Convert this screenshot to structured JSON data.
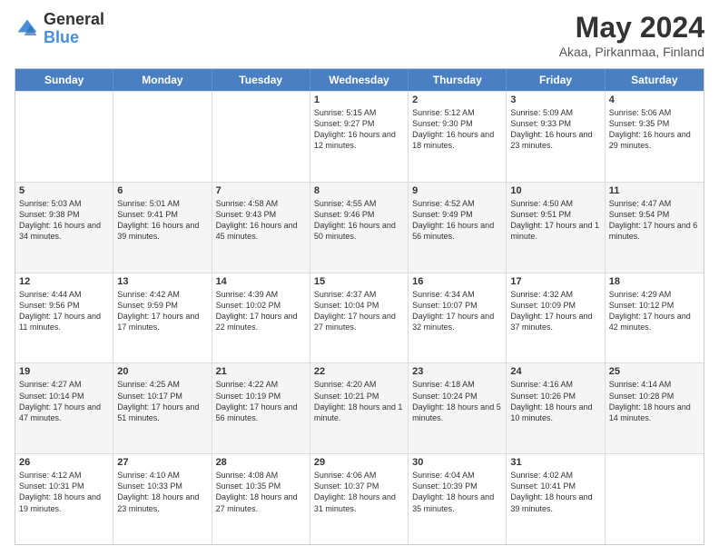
{
  "logo": {
    "general": "General",
    "blue": "Blue"
  },
  "title": "May 2024",
  "subtitle": "Akaa, Pirkanmaa, Finland",
  "days_of_week": [
    "Sunday",
    "Monday",
    "Tuesday",
    "Wednesday",
    "Thursday",
    "Friday",
    "Saturday"
  ],
  "weeks": [
    [
      {
        "day": "",
        "info": "",
        "empty": true
      },
      {
        "day": "",
        "info": "",
        "empty": true
      },
      {
        "day": "",
        "info": "",
        "empty": true
      },
      {
        "day": "1",
        "info": "Sunrise: 5:15 AM\nSunset: 9:27 PM\nDaylight: 16 hours\nand 12 minutes."
      },
      {
        "day": "2",
        "info": "Sunrise: 5:12 AM\nSunset: 9:30 PM\nDaylight: 16 hours\nand 18 minutes."
      },
      {
        "day": "3",
        "info": "Sunrise: 5:09 AM\nSunset: 9:33 PM\nDaylight: 16 hours\nand 23 minutes."
      },
      {
        "day": "4",
        "info": "Sunrise: 5:06 AM\nSunset: 9:35 PM\nDaylight: 16 hours\nand 29 minutes."
      }
    ],
    [
      {
        "day": "5",
        "info": "Sunrise: 5:03 AM\nSunset: 9:38 PM\nDaylight: 16 hours\nand 34 minutes."
      },
      {
        "day": "6",
        "info": "Sunrise: 5:01 AM\nSunset: 9:41 PM\nDaylight: 16 hours\nand 39 minutes."
      },
      {
        "day": "7",
        "info": "Sunrise: 4:58 AM\nSunset: 9:43 PM\nDaylight: 16 hours\nand 45 minutes."
      },
      {
        "day": "8",
        "info": "Sunrise: 4:55 AM\nSunset: 9:46 PM\nDaylight: 16 hours\nand 50 minutes."
      },
      {
        "day": "9",
        "info": "Sunrise: 4:52 AM\nSunset: 9:49 PM\nDaylight: 16 hours\nand 56 minutes."
      },
      {
        "day": "10",
        "info": "Sunrise: 4:50 AM\nSunset: 9:51 PM\nDaylight: 17 hours\nand 1 minute."
      },
      {
        "day": "11",
        "info": "Sunrise: 4:47 AM\nSunset: 9:54 PM\nDaylight: 17 hours\nand 6 minutes."
      }
    ],
    [
      {
        "day": "12",
        "info": "Sunrise: 4:44 AM\nSunset: 9:56 PM\nDaylight: 17 hours\nand 11 minutes."
      },
      {
        "day": "13",
        "info": "Sunrise: 4:42 AM\nSunset: 9:59 PM\nDaylight: 17 hours\nand 17 minutes."
      },
      {
        "day": "14",
        "info": "Sunrise: 4:39 AM\nSunset: 10:02 PM\nDaylight: 17 hours\nand 22 minutes."
      },
      {
        "day": "15",
        "info": "Sunrise: 4:37 AM\nSunset: 10:04 PM\nDaylight: 17 hours\nand 27 minutes."
      },
      {
        "day": "16",
        "info": "Sunrise: 4:34 AM\nSunset: 10:07 PM\nDaylight: 17 hours\nand 32 minutes."
      },
      {
        "day": "17",
        "info": "Sunrise: 4:32 AM\nSunset: 10:09 PM\nDaylight: 17 hours\nand 37 minutes."
      },
      {
        "day": "18",
        "info": "Sunrise: 4:29 AM\nSunset: 10:12 PM\nDaylight: 17 hours\nand 42 minutes."
      }
    ],
    [
      {
        "day": "19",
        "info": "Sunrise: 4:27 AM\nSunset: 10:14 PM\nDaylight: 17 hours\nand 47 minutes."
      },
      {
        "day": "20",
        "info": "Sunrise: 4:25 AM\nSunset: 10:17 PM\nDaylight: 17 hours\nand 51 minutes."
      },
      {
        "day": "21",
        "info": "Sunrise: 4:22 AM\nSunset: 10:19 PM\nDaylight: 17 hours\nand 56 minutes."
      },
      {
        "day": "22",
        "info": "Sunrise: 4:20 AM\nSunset: 10:21 PM\nDaylight: 18 hours\nand 1 minute."
      },
      {
        "day": "23",
        "info": "Sunrise: 4:18 AM\nSunset: 10:24 PM\nDaylight: 18 hours\nand 5 minutes."
      },
      {
        "day": "24",
        "info": "Sunrise: 4:16 AM\nSunset: 10:26 PM\nDaylight: 18 hours\nand 10 minutes."
      },
      {
        "day": "25",
        "info": "Sunrise: 4:14 AM\nSunset: 10:28 PM\nDaylight: 18 hours\nand 14 minutes."
      }
    ],
    [
      {
        "day": "26",
        "info": "Sunrise: 4:12 AM\nSunset: 10:31 PM\nDaylight: 18 hours\nand 19 minutes."
      },
      {
        "day": "27",
        "info": "Sunrise: 4:10 AM\nSunset: 10:33 PM\nDaylight: 18 hours\nand 23 minutes."
      },
      {
        "day": "28",
        "info": "Sunrise: 4:08 AM\nSunset: 10:35 PM\nDaylight: 18 hours\nand 27 minutes."
      },
      {
        "day": "29",
        "info": "Sunrise: 4:06 AM\nSunset: 10:37 PM\nDaylight: 18 hours\nand 31 minutes."
      },
      {
        "day": "30",
        "info": "Sunrise: 4:04 AM\nSunset: 10:39 PM\nDaylight: 18 hours\nand 35 minutes."
      },
      {
        "day": "31",
        "info": "Sunrise: 4:02 AM\nSunset: 10:41 PM\nDaylight: 18 hours\nand 39 minutes."
      },
      {
        "day": "",
        "info": "",
        "empty": true
      }
    ]
  ]
}
